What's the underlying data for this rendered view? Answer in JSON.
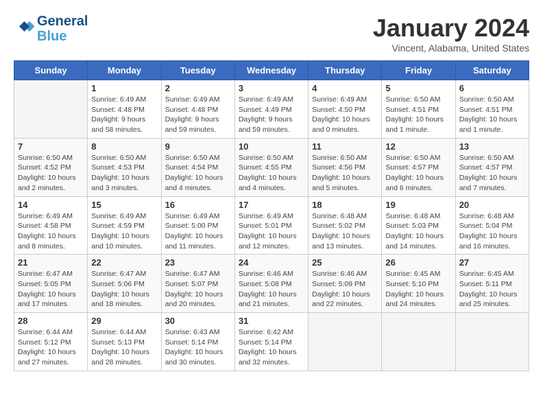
{
  "header": {
    "logo_line1": "General",
    "logo_line2": "Blue",
    "title": "January 2024",
    "subtitle": "Vincent, Alabama, United States"
  },
  "days_of_week": [
    "Sunday",
    "Monday",
    "Tuesday",
    "Wednesday",
    "Thursday",
    "Friday",
    "Saturday"
  ],
  "weeks": [
    [
      {
        "day": "",
        "sunrise": "",
        "sunset": "",
        "daylight": ""
      },
      {
        "day": "1",
        "sunrise": "Sunrise: 6:49 AM",
        "sunset": "Sunset: 4:48 PM",
        "daylight": "Daylight: 9 hours and 58 minutes."
      },
      {
        "day": "2",
        "sunrise": "Sunrise: 6:49 AM",
        "sunset": "Sunset: 4:48 PM",
        "daylight": "Daylight: 9 hours and 59 minutes."
      },
      {
        "day": "3",
        "sunrise": "Sunrise: 6:49 AM",
        "sunset": "Sunset: 4:49 PM",
        "daylight": "Daylight: 9 hours and 59 minutes."
      },
      {
        "day": "4",
        "sunrise": "Sunrise: 6:49 AM",
        "sunset": "Sunset: 4:50 PM",
        "daylight": "Daylight: 10 hours and 0 minutes."
      },
      {
        "day": "5",
        "sunrise": "Sunrise: 6:50 AM",
        "sunset": "Sunset: 4:51 PM",
        "daylight": "Daylight: 10 hours and 1 minute."
      },
      {
        "day": "6",
        "sunrise": "Sunrise: 6:50 AM",
        "sunset": "Sunset: 4:51 PM",
        "daylight": "Daylight: 10 hours and 1 minute."
      }
    ],
    [
      {
        "day": "7",
        "sunrise": "Sunrise: 6:50 AM",
        "sunset": "Sunset: 4:52 PM",
        "daylight": "Daylight: 10 hours and 2 minutes."
      },
      {
        "day": "8",
        "sunrise": "Sunrise: 6:50 AM",
        "sunset": "Sunset: 4:53 PM",
        "daylight": "Daylight: 10 hours and 3 minutes."
      },
      {
        "day": "9",
        "sunrise": "Sunrise: 6:50 AM",
        "sunset": "Sunset: 4:54 PM",
        "daylight": "Daylight: 10 hours and 4 minutes."
      },
      {
        "day": "10",
        "sunrise": "Sunrise: 6:50 AM",
        "sunset": "Sunset: 4:55 PM",
        "daylight": "Daylight: 10 hours and 4 minutes."
      },
      {
        "day": "11",
        "sunrise": "Sunrise: 6:50 AM",
        "sunset": "Sunset: 4:56 PM",
        "daylight": "Daylight: 10 hours and 5 minutes."
      },
      {
        "day": "12",
        "sunrise": "Sunrise: 6:50 AM",
        "sunset": "Sunset: 4:57 PM",
        "daylight": "Daylight: 10 hours and 6 minutes."
      },
      {
        "day": "13",
        "sunrise": "Sunrise: 6:50 AM",
        "sunset": "Sunset: 4:57 PM",
        "daylight": "Daylight: 10 hours and 7 minutes."
      }
    ],
    [
      {
        "day": "14",
        "sunrise": "Sunrise: 6:49 AM",
        "sunset": "Sunset: 4:58 PM",
        "daylight": "Daylight: 10 hours and 8 minutes."
      },
      {
        "day": "15",
        "sunrise": "Sunrise: 6:49 AM",
        "sunset": "Sunset: 4:59 PM",
        "daylight": "Daylight: 10 hours and 10 minutes."
      },
      {
        "day": "16",
        "sunrise": "Sunrise: 6:49 AM",
        "sunset": "Sunset: 5:00 PM",
        "daylight": "Daylight: 10 hours and 11 minutes."
      },
      {
        "day": "17",
        "sunrise": "Sunrise: 6:49 AM",
        "sunset": "Sunset: 5:01 PM",
        "daylight": "Daylight: 10 hours and 12 minutes."
      },
      {
        "day": "18",
        "sunrise": "Sunrise: 6:48 AM",
        "sunset": "Sunset: 5:02 PM",
        "daylight": "Daylight: 10 hours and 13 minutes."
      },
      {
        "day": "19",
        "sunrise": "Sunrise: 6:48 AM",
        "sunset": "Sunset: 5:03 PM",
        "daylight": "Daylight: 10 hours and 14 minutes."
      },
      {
        "day": "20",
        "sunrise": "Sunrise: 6:48 AM",
        "sunset": "Sunset: 5:04 PM",
        "daylight": "Daylight: 10 hours and 16 minutes."
      }
    ],
    [
      {
        "day": "21",
        "sunrise": "Sunrise: 6:47 AM",
        "sunset": "Sunset: 5:05 PM",
        "daylight": "Daylight: 10 hours and 17 minutes."
      },
      {
        "day": "22",
        "sunrise": "Sunrise: 6:47 AM",
        "sunset": "Sunset: 5:06 PM",
        "daylight": "Daylight: 10 hours and 18 minutes."
      },
      {
        "day": "23",
        "sunrise": "Sunrise: 6:47 AM",
        "sunset": "Sunset: 5:07 PM",
        "daylight": "Daylight: 10 hours and 20 minutes."
      },
      {
        "day": "24",
        "sunrise": "Sunrise: 6:46 AM",
        "sunset": "Sunset: 5:08 PM",
        "daylight": "Daylight: 10 hours and 21 minutes."
      },
      {
        "day": "25",
        "sunrise": "Sunrise: 6:46 AM",
        "sunset": "Sunset: 5:09 PM",
        "daylight": "Daylight: 10 hours and 22 minutes."
      },
      {
        "day": "26",
        "sunrise": "Sunrise: 6:45 AM",
        "sunset": "Sunset: 5:10 PM",
        "daylight": "Daylight: 10 hours and 24 minutes."
      },
      {
        "day": "27",
        "sunrise": "Sunrise: 6:45 AM",
        "sunset": "Sunset: 5:11 PM",
        "daylight": "Daylight: 10 hours and 25 minutes."
      }
    ],
    [
      {
        "day": "28",
        "sunrise": "Sunrise: 6:44 AM",
        "sunset": "Sunset: 5:12 PM",
        "daylight": "Daylight: 10 hours and 27 minutes."
      },
      {
        "day": "29",
        "sunrise": "Sunrise: 6:44 AM",
        "sunset": "Sunset: 5:13 PM",
        "daylight": "Daylight: 10 hours and 28 minutes."
      },
      {
        "day": "30",
        "sunrise": "Sunrise: 6:43 AM",
        "sunset": "Sunset: 5:14 PM",
        "daylight": "Daylight: 10 hours and 30 minutes."
      },
      {
        "day": "31",
        "sunrise": "Sunrise: 6:42 AM",
        "sunset": "Sunset: 5:14 PM",
        "daylight": "Daylight: 10 hours and 32 minutes."
      },
      {
        "day": "",
        "sunrise": "",
        "sunset": "",
        "daylight": ""
      },
      {
        "day": "",
        "sunrise": "",
        "sunset": "",
        "daylight": ""
      },
      {
        "day": "",
        "sunrise": "",
        "sunset": "",
        "daylight": ""
      }
    ]
  ]
}
